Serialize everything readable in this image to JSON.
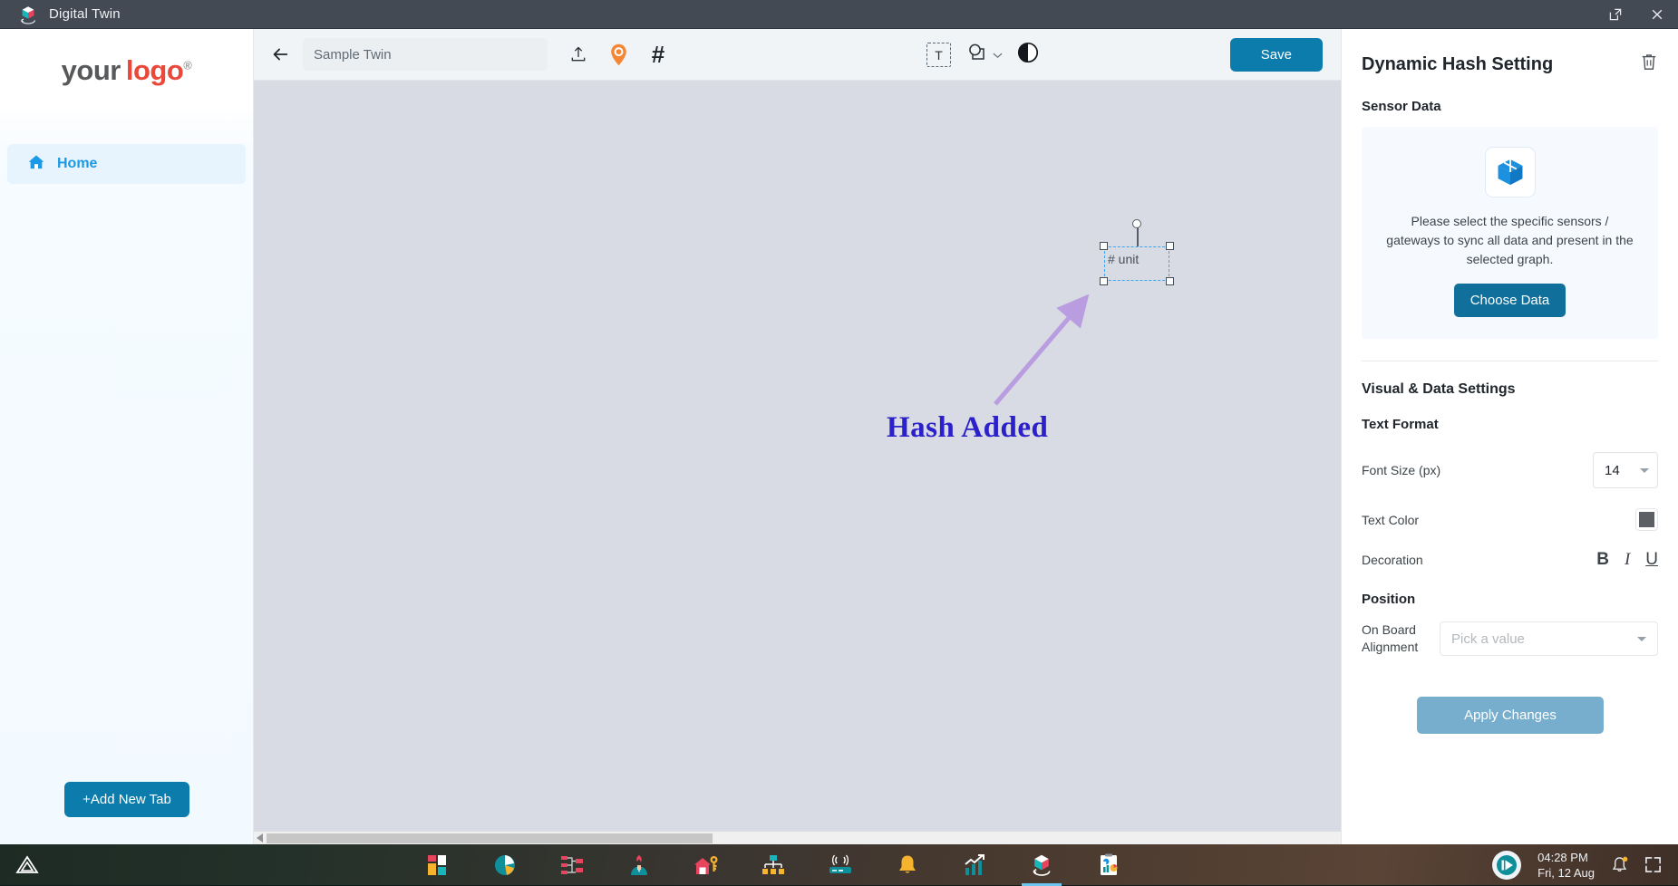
{
  "titlebar": {
    "title": "Digital Twin",
    "logo_icon": "cube-3d-icon",
    "restore_icon": "external-window-icon",
    "close_icon": "close-icon"
  },
  "sidebar": {
    "logo": {
      "part1": "your",
      "part2": "logo",
      "mark": "®"
    },
    "nav": [
      {
        "label": "Home",
        "icon": "home-icon",
        "active": true
      }
    ],
    "add_tab_label": "+Add New Tab"
  },
  "toolbar": {
    "back_icon": "arrow-left-icon",
    "twin_name_value": "Sample Twin",
    "twin_name_placeholder": "Sample Twin",
    "upload_icon": "upload-icon",
    "pin_icon": "location-pin-icon",
    "hash_icon": "#",
    "text_tool_label": "T",
    "shape_tool_icon": "shapes-icon",
    "shape_caret_icon": "chevron-down-icon",
    "contrast_icon": "contrast-icon",
    "save_label": "Save"
  },
  "canvas": {
    "hash_element_text": "# unit",
    "annotation_label": "Hash Added",
    "annotation_arrow_icon": "arrow-up-right-icon",
    "scrollbar_left_icon": "scroll-left-arrow"
  },
  "panel": {
    "title": "Dynamic Hash Setting",
    "trash_icon": "trash-icon",
    "sensor_section_label": "Sensor Data",
    "sensor_card": {
      "icon": "cube-3d-icon",
      "description": "Please select the specific sensors / gateways to sync all data and present in the selected graph.",
      "button_label": "Choose Data"
    },
    "visual_section_label": "Visual & Data Settings",
    "text_format_label": "Text Format",
    "font_size_label": "Font Size (px)",
    "font_size_value": "14",
    "font_size_caret": "chevron-down-icon",
    "text_color_label": "Text Color",
    "text_color_value": "#5c5f63",
    "decoration_label": "Decoration",
    "decoration_bold": "B",
    "decoration_italic": "I",
    "decoration_underline": "U",
    "position_label": "Position",
    "alignment_label": "On Board Alignment",
    "alignment_placeholder": "Pick a value",
    "alignment_caret": "chevron-down-icon",
    "apply_label": "Apply Changes"
  },
  "taskbar": {
    "start_icon": "triangle-icon",
    "apps": [
      {
        "name": "dashboard-tiles-icon"
      },
      {
        "name": "pie-chart-icon"
      },
      {
        "name": "hierarchy-icon"
      },
      {
        "name": "user-profile-icon"
      },
      {
        "name": "home-key-icon"
      },
      {
        "name": "org-chart-icon"
      },
      {
        "name": "router-icon"
      },
      {
        "name": "bell-alert-icon"
      },
      {
        "name": "trending-chart-icon"
      },
      {
        "name": "digital-twin-icon"
      },
      {
        "name": "report-icon"
      }
    ],
    "media_icon": "media-player-icon",
    "time": "04:28 PM",
    "date": "Fri, 12 Aug",
    "bell_icon": "notification-bell-icon",
    "expand_icon": "expand-icon"
  },
  "colors": {
    "accent_blue": "#0c7cac",
    "title_bar": "#434a54",
    "canvas_bg": "#d8dae4",
    "annotation": "#2b20c9",
    "arrow": "#b99de0",
    "selection": "#3aa7f0",
    "pin_orange": "#f58634"
  }
}
